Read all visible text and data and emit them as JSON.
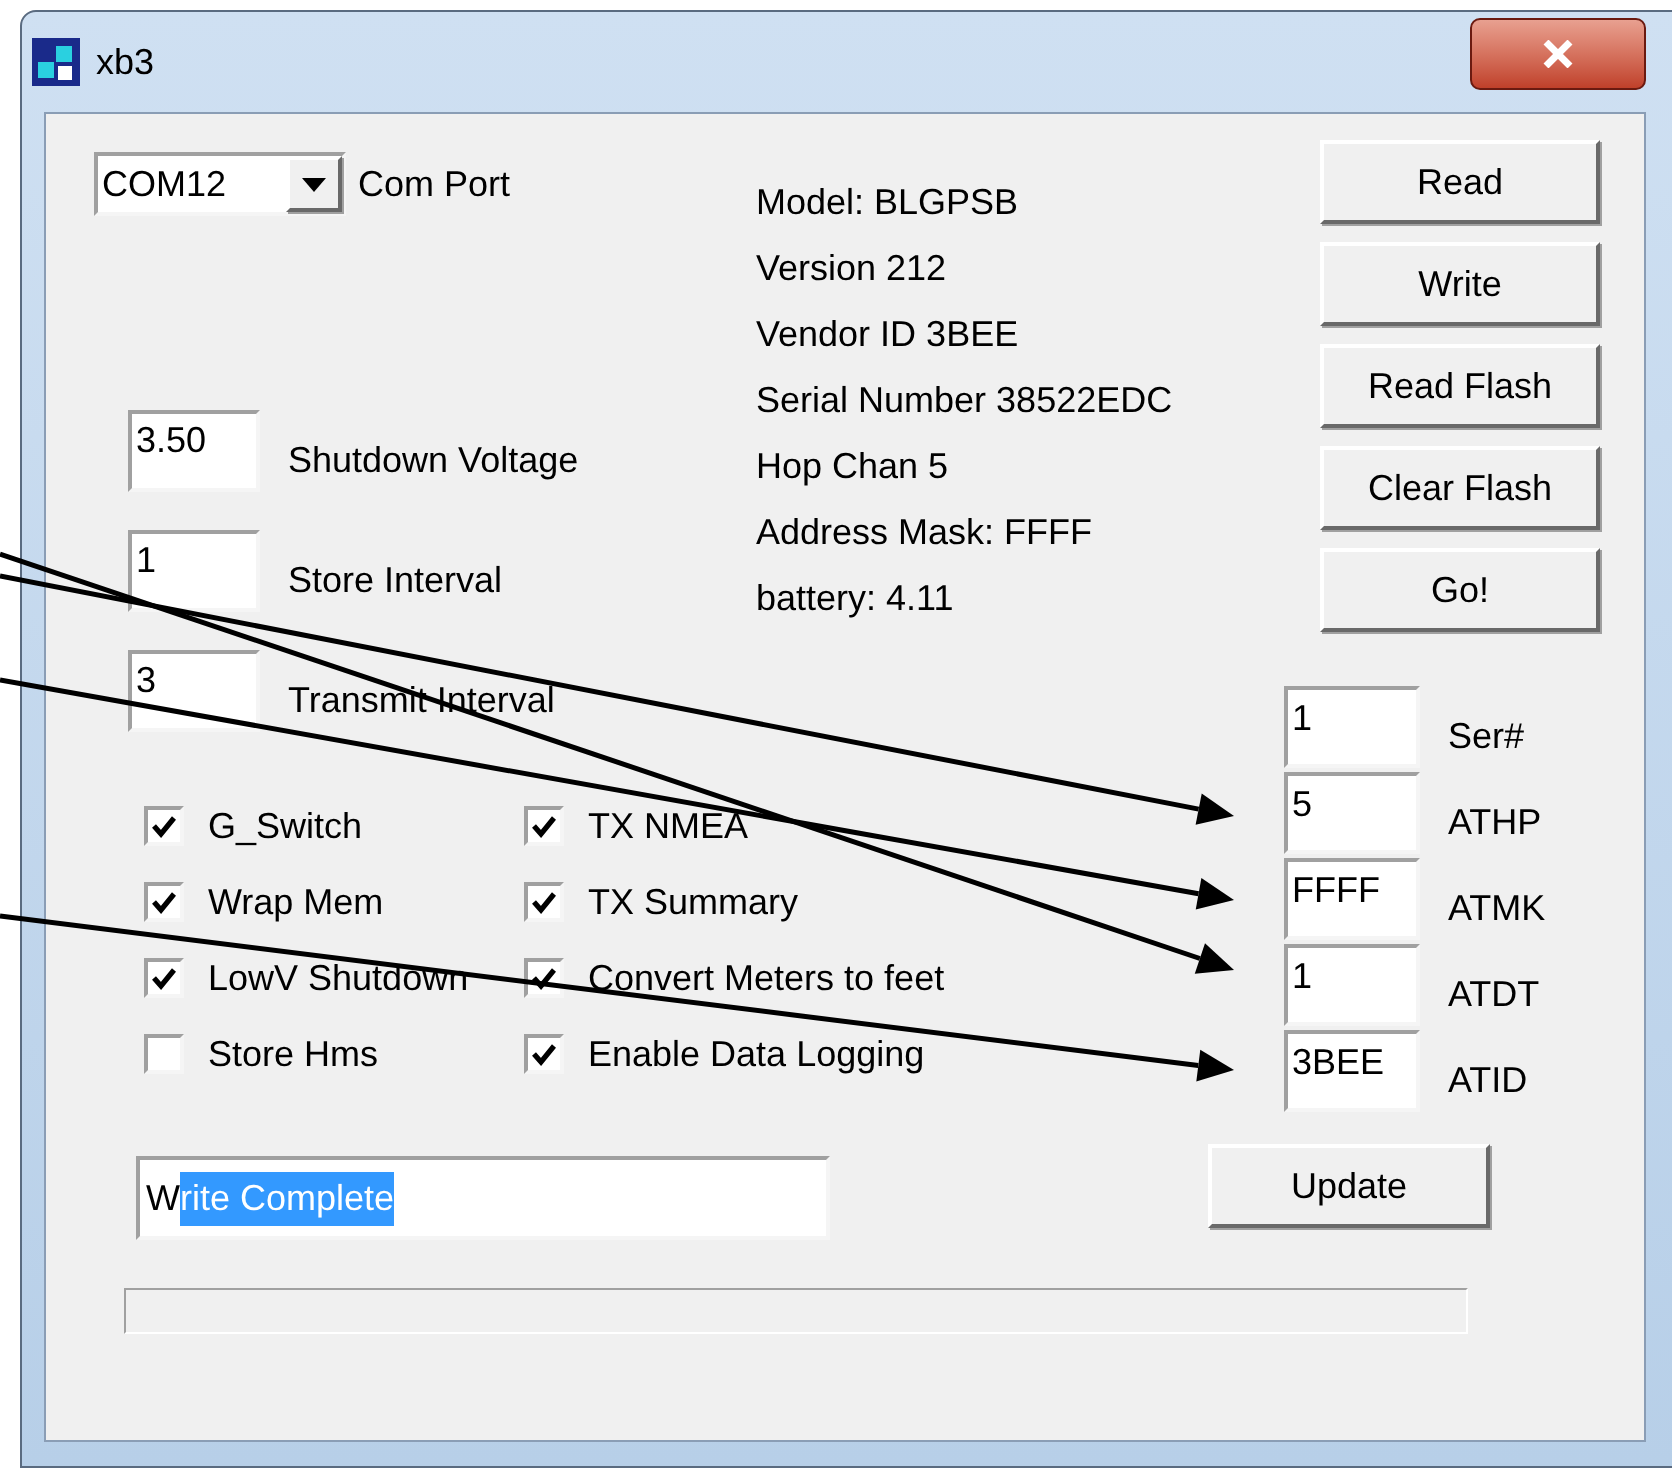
{
  "window": {
    "title": "xb3"
  },
  "com_port": {
    "value": "COM12",
    "label": "Com Port"
  },
  "info": [
    "Model: BLGPSB",
    "Version 212",
    "Vendor ID 3BEE",
    "Serial Number 38522EDC",
    "Hop Chan 5",
    "Address Mask: FFFF",
    "battery: 4.11"
  ],
  "buttons": [
    "Read",
    "Write",
    "Read Flash",
    "Clear Flash",
    "Go!"
  ],
  "settings": [
    {
      "value": "3.50",
      "label": "Shutdown Voltage"
    },
    {
      "value": "1",
      "label": "Store Interval"
    },
    {
      "value": "3",
      "label": "Transmit Interval"
    }
  ],
  "checkboxes": [
    {
      "label": "G_Switch",
      "checked": true
    },
    {
      "label": "TX NMEA",
      "checked": true
    },
    {
      "label": "Wrap Mem",
      "checked": true
    },
    {
      "label": "TX Summary",
      "checked": true
    },
    {
      "label": "LowV Shutdown",
      "checked": true
    },
    {
      "label": "Convert Meters to feet",
      "checked": true
    },
    {
      "label": "Store Hms",
      "checked": false
    },
    {
      "label": "Enable Data Logging",
      "checked": true
    }
  ],
  "at_fields": [
    {
      "value": "1",
      "label": "Ser#"
    },
    {
      "value": "5",
      "label": "ATHP"
    },
    {
      "value": "FFFF",
      "label": "ATMK"
    },
    {
      "value": "1",
      "label": "ATDT"
    },
    {
      "value": "3BEE",
      "label": "ATID"
    }
  ],
  "status": {
    "value": [
      {
        "text": "W",
        "selected": false
      },
      {
        "text": "rite Complete",
        "selected": true
      }
    ]
  },
  "update_button": "Update",
  "progress": {
    "level": 0
  }
}
